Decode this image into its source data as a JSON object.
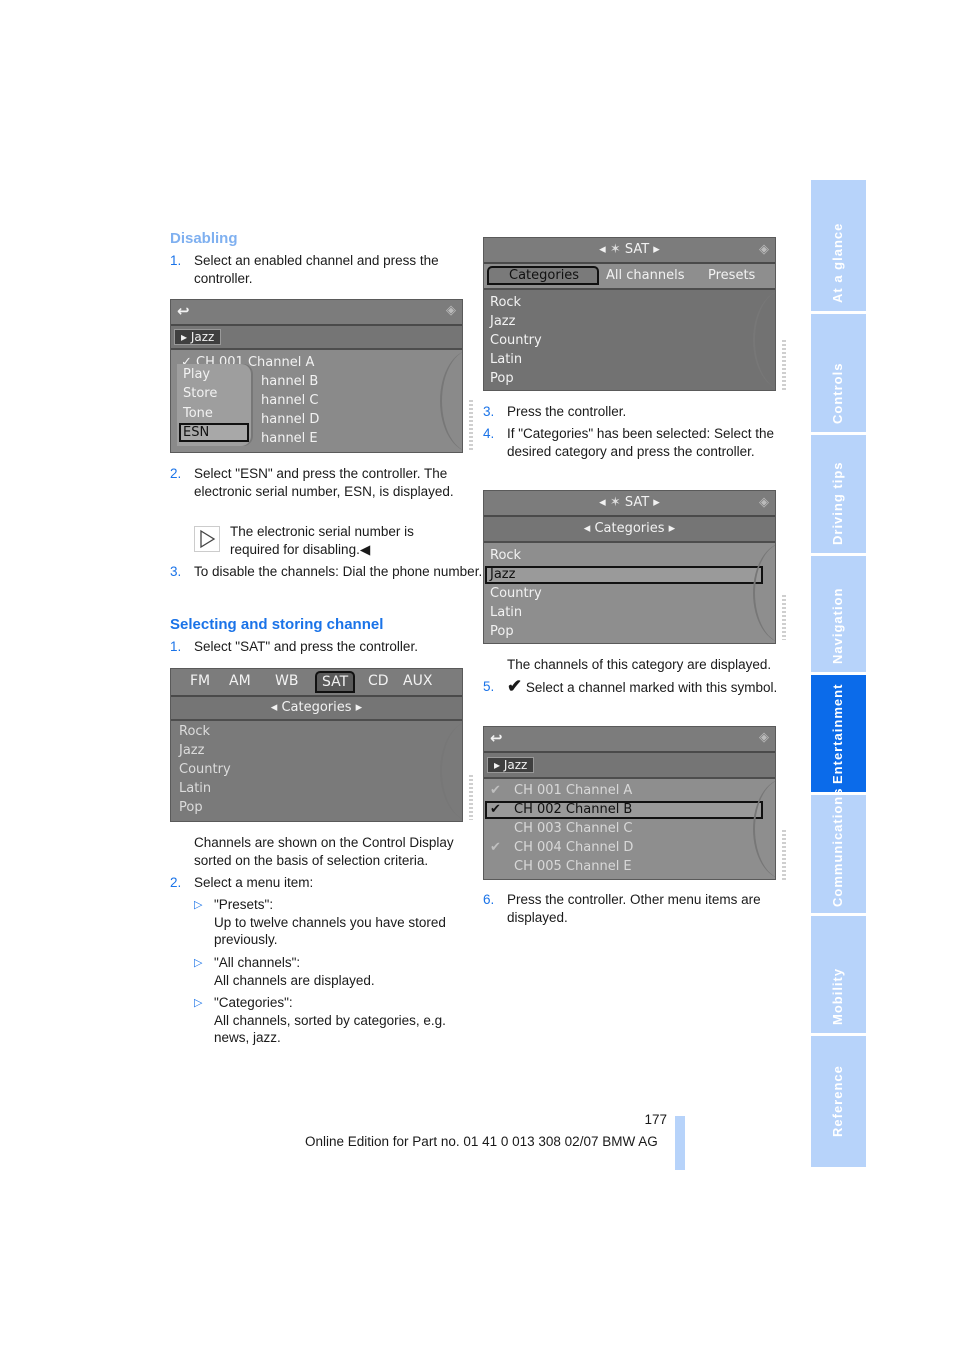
{
  "left": {
    "heading_disabling": "Disabling",
    "step1_num": "1.",
    "step1_text": "Select an enabled channel and press the controller.",
    "screen1": {
      "back_icon": "back-arrow-icon",
      "breadcrumb": "Jazz",
      "channels": [
        "CH 001 Channel A",
        "hannel B",
        "hannel C",
        "hannel D",
        "hannel E"
      ],
      "popup_items": [
        "Play",
        "Store",
        "Tone",
        "ESN"
      ],
      "popup_selected": "ESN"
    },
    "step2_num": "2.",
    "step2_text": "Select \"ESN\" and press the controller. The electronic serial number, ESN, is displayed.",
    "note_text": "The electronic serial number is required for disabling.◀",
    "step3_num": "3.",
    "step3_text": "To disable the channels: Dial the phone number.",
    "heading_selecting": "Selecting and storing channel",
    "sel_step1_num": "1.",
    "sel_step1_text": "Select \"SAT\" and press the controller.",
    "screen2": {
      "tabs": [
        "FM",
        "AM",
        "WB",
        "SAT",
        "CD",
        "AUX"
      ],
      "active_tab": "SAT",
      "subheader": "Categories",
      "categories": [
        "Rock",
        "Jazz",
        "Country",
        "Latin",
        "Pop"
      ]
    },
    "channels_desc": "Channels are shown on the Control Display sorted on the basis of selection criteria.",
    "sel_step2_num": "2.",
    "sel_step2_text": "Select a menu item:",
    "menu_items": [
      {
        "title": "\"Presets\":",
        "desc": "Up to twelve channels you have stored previously."
      },
      {
        "title": "\"All channels\":",
        "desc": "All channels are displayed."
      },
      {
        "title": "\"Categories\":",
        "desc": "All channels, sorted by categories, e.g. news, jazz."
      }
    ]
  },
  "right": {
    "screen3": {
      "title": "SAT",
      "tabs": [
        "Categories",
        "All channels",
        "Presets"
      ],
      "active_tab": "Categories",
      "categories": [
        "Rock",
        "Jazz",
        "Country",
        "Latin",
        "Pop"
      ]
    },
    "step3_num": "3.",
    "step3_text": "Press the controller.",
    "step4_num": "4.",
    "step4_text": "If \"Categories\" has been selected: Select the desired category and press the controller.",
    "screen4": {
      "title": "SAT",
      "subheader": "Categories",
      "categories": [
        "Rock",
        "Jazz",
        "Country",
        "Latin",
        "Pop"
      ],
      "selected": "Jazz"
    },
    "category_desc": "The channels of this category are displayed.",
    "step5_num": "5.",
    "step5_text": "Select a channel marked with this symbol.",
    "screen5": {
      "breadcrumb": "Jazz",
      "channels": [
        "CH 001 Channel A",
        "CH 002 Channel B",
        "CH 003 Channel C",
        "CH 004 Channel D",
        "CH 005 Channel E"
      ],
      "checked": [
        true,
        true,
        false,
        true,
        false
      ],
      "selected": "CH 002 Channel B"
    },
    "step6_num": "6.",
    "step6_text": "Press the controller. Other menu items are displayed."
  },
  "sidebar": {
    "tabs": [
      "At a glance",
      "Controls",
      "Driving tips",
      "Navigation",
      "Entertainment",
      "Communications",
      "Mobility",
      "Reference"
    ],
    "active": "Entertainment"
  },
  "footer": {
    "page_number": "177",
    "edition": "Online Edition for Part no. 01 41 0 013 308 02/07 BMW AG"
  },
  "colors": {
    "accent": "#1a73e8",
    "sidebar_tab": "#b7d3fa",
    "sidebar_active": "#0b6bea"
  }
}
